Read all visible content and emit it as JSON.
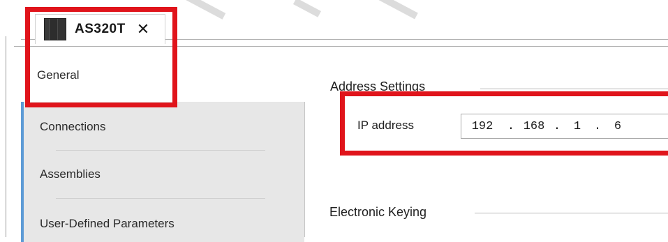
{
  "tab": {
    "title": "AS320T",
    "close_glyph": "✕",
    "icon": "plc-module-icon"
  },
  "sidebar": {
    "items": [
      {
        "label": "General",
        "selected": true
      },
      {
        "label": "Connections"
      },
      {
        "label": "Assemblies"
      },
      {
        "label": "User-Defined Parameters"
      }
    ]
  },
  "main": {
    "address_settings": {
      "title": "Address Settings",
      "ip_label": "IP address",
      "ip_octets": [
        "192",
        "168",
        "1",
        "6"
      ],
      "separator": "."
    },
    "electronic_keying": {
      "title": "Electronic Keying"
    }
  },
  "colors": {
    "highlight": "#e0141b",
    "sidebar_bg": "#e7e7e7",
    "sidebar_accent": "#5d9bd6"
  }
}
